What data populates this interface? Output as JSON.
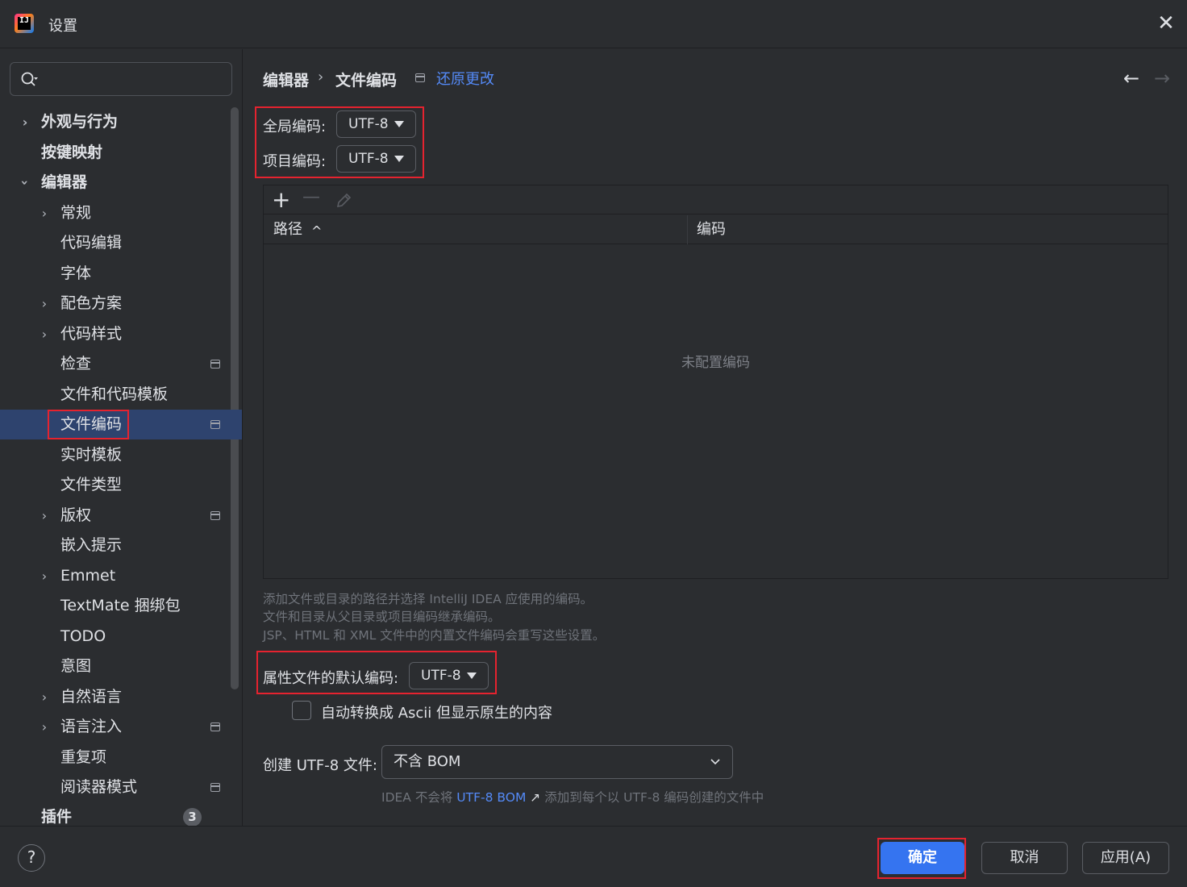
{
  "window": {
    "title": "设置",
    "logo_text": "IJ"
  },
  "search": {
    "placeholder": ""
  },
  "sidebar": {
    "items": [
      {
        "label": "外观与行为"
      },
      {
        "label": "按键映射"
      },
      {
        "label": "编辑器"
      },
      {
        "label": "常规"
      },
      {
        "label": "代码编辑"
      },
      {
        "label": "字体"
      },
      {
        "label": "配色方案"
      },
      {
        "label": "代码样式"
      },
      {
        "label": "检查"
      },
      {
        "label": "文件和代码模板"
      },
      {
        "label": "文件编码"
      },
      {
        "label": "实时模板"
      },
      {
        "label": "文件类型"
      },
      {
        "label": "版权"
      },
      {
        "label": "嵌入提示"
      },
      {
        "label": "Emmet"
      },
      {
        "label": "TextMate 捆绑包"
      },
      {
        "label": "TODO"
      },
      {
        "label": "意图"
      },
      {
        "label": "自然语言"
      },
      {
        "label": "语言注入"
      },
      {
        "label": "重复项"
      },
      {
        "label": "阅读器模式"
      },
      {
        "label": "插件",
        "badge": "3"
      }
    ]
  },
  "breadcrumb": {
    "parent": "编辑器",
    "separator": "›",
    "current": "文件编码",
    "revert": "还原更改"
  },
  "nav": {
    "back": "←",
    "forward": "→"
  },
  "encoding": {
    "global_label": "全局编码:",
    "global_value": "UTF-8",
    "project_label": "项目编码:",
    "project_value": "UTF-8"
  },
  "table": {
    "add": "+",
    "remove": "—",
    "columns": {
      "path": "路径",
      "sort_indicator": "^",
      "encoding": "编码"
    },
    "empty": "未配置编码"
  },
  "hints": {
    "line1": "添加文件或目录的路径并选择 IntelliJ IDEA 应使用的编码。",
    "line2": "文件和目录从父目录或项目编码继承编码。",
    "line3": "JSP、HTML 和 XML 文件中的内置文件编码会重写这些设置。"
  },
  "properties": {
    "label": "属性文件的默认编码:",
    "value": "UTF-8",
    "ascii_checkbox": "自动转换成 Ascii 但显示原生的内容"
  },
  "bom": {
    "label": "创建 UTF-8 文件:",
    "value": "不含 BOM",
    "hint_prefix": "IDEA 不会将",
    "hint_link": "UTF-8 BOM",
    "hint_arrow": "↗",
    "hint_suffix": "添加到每个以 UTF-8 编码创建的文件中"
  },
  "footer": {
    "help": "?",
    "ok": "确定",
    "cancel": "取消",
    "apply": "应用(A)"
  },
  "colors": {
    "accent": "#3574f0",
    "selection": "#2e436e",
    "highlight_box": "#e5232f",
    "link": "#548af7"
  }
}
